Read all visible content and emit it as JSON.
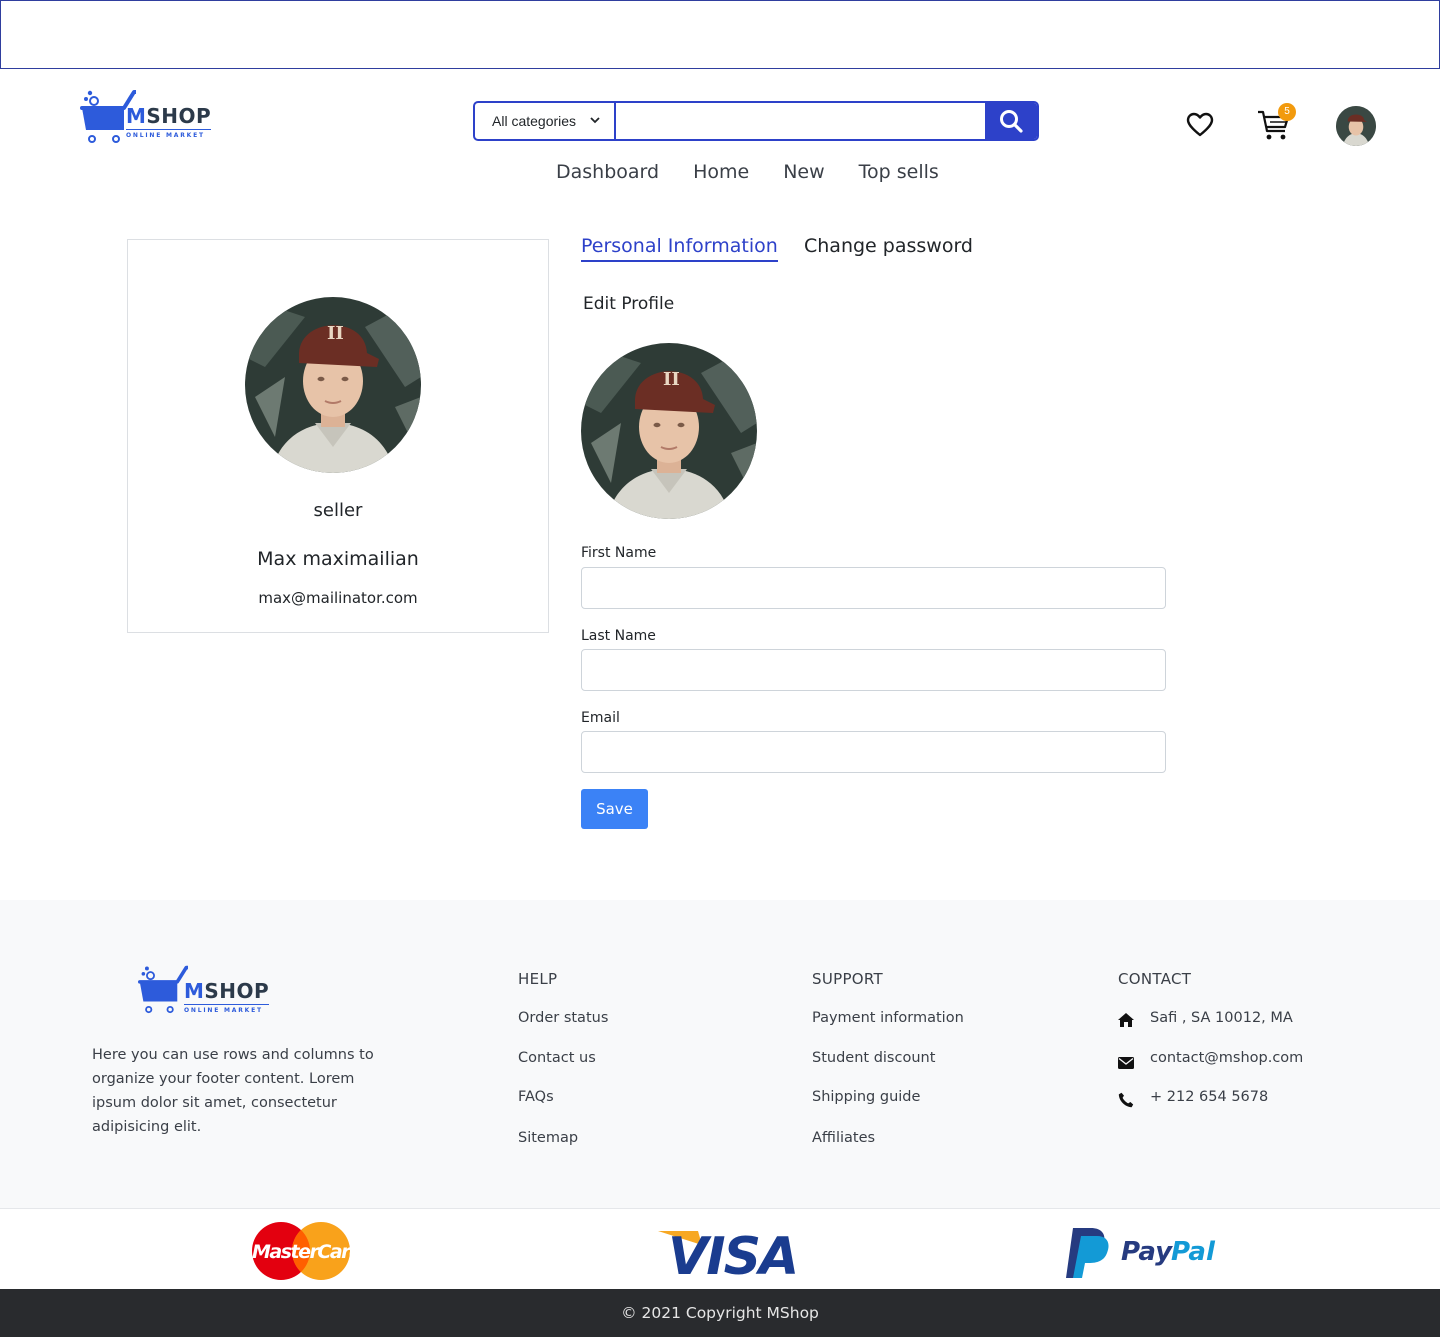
{
  "brand": {
    "name_m": "M",
    "name_rest": "SHOP",
    "tagline": "ONLINE MARKET"
  },
  "search": {
    "category": "All categories",
    "placeholder": "",
    "value": ""
  },
  "header": {
    "cart_count": "5"
  },
  "nav": {
    "items": [
      "Dashboard",
      "Home",
      "New",
      "Top sells"
    ]
  },
  "profile": {
    "role": "seller",
    "name": "Max maximailian",
    "email": "max@mailinator.com"
  },
  "tabs": {
    "personal": "Personal Information",
    "password": "Change password",
    "active": "personal"
  },
  "form": {
    "title": "Edit Profile",
    "first_name_label": "First Name",
    "last_name_label": "Last Name",
    "email_label": "Email",
    "first_name_value": "",
    "last_name_value": "",
    "email_value": "",
    "save_label": "Save"
  },
  "footer": {
    "about": "Here you can use rows and columns to organize your footer content. Lorem ipsum dolor sit amet, consectetur adipisicing elit.",
    "help_title": "HELP",
    "help_links": [
      "Order status",
      "Contact us",
      "FAQs",
      "Sitemap"
    ],
    "support_title": "SUPPORT",
    "support_links": [
      "Payment information",
      "Student discount",
      "Shipping guide",
      "Affiliates"
    ],
    "contact_title": "CONTACT",
    "contact_address": "Safi , SA 10012, MA",
    "contact_email": "contact@mshop.com",
    "contact_phone": "+ 212 654 5678",
    "copyright": "© 2021 Copyright MShop"
  },
  "payments": {
    "mastercard": "MasterCard",
    "visa": "VISA",
    "paypal_1": "Pay",
    "paypal_2": "Pal"
  },
  "colors": {
    "accent": "#2d41c9",
    "brand_blue": "#2d5bdb",
    "save": "#3b82f6",
    "badge": "#f29a0d",
    "footer_bg": "#f8f9fa",
    "copyright_bg": "#292b2e"
  }
}
